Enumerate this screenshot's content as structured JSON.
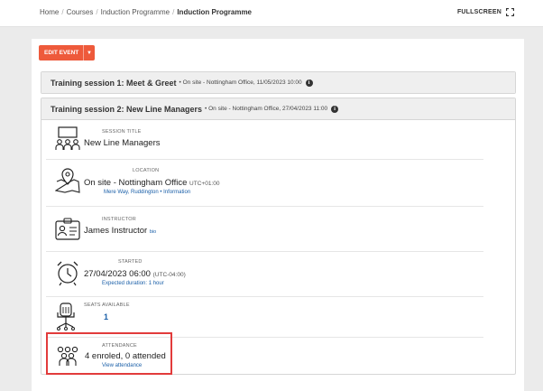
{
  "breadcrumb": {
    "items": [
      "Home",
      "Courses",
      "Induction Programme"
    ],
    "current": "Induction Programme"
  },
  "fullscreen_label": "FULLSCREEN",
  "edit_event": {
    "label": "EDIT EVENT"
  },
  "sessions": [
    {
      "title": "Training session 1: Meet & Greet",
      "meta": "• On site - Nottingham Office, 11/05/2023 10:00"
    },
    {
      "title": "Training session 2: New Line Managers",
      "meta": "• On site - Nottingham Office, 27/04/2023 11:00"
    }
  ],
  "details": {
    "session_title": {
      "label": "SESSION TITLE",
      "value": "New Line Managers"
    },
    "location": {
      "label": "LOCATION",
      "value": "On site - Nottingham Office",
      "tz": "UTC+01:00",
      "address": "Mere Way, Ruddington",
      "info_link": "Information"
    },
    "instructor": {
      "label": "INSTRUCTOR",
      "value": "James Instructor",
      "bio": "bio"
    },
    "started": {
      "label": "STARTED",
      "value": "27/04/2023 06:00",
      "tz": "(UTC-04:00)",
      "duration": "Expected duration: 1 hour"
    },
    "seats": {
      "label": "SEATS AVAILABLE",
      "value": "1"
    },
    "attendance": {
      "label": "ATTENDANCE",
      "value": "4 enroled, 0 attended",
      "link": "View attendance"
    }
  },
  "colors": {
    "accent": "#ee5a3b",
    "link": "#1a5fa8",
    "highlight": "#e23b3b"
  }
}
